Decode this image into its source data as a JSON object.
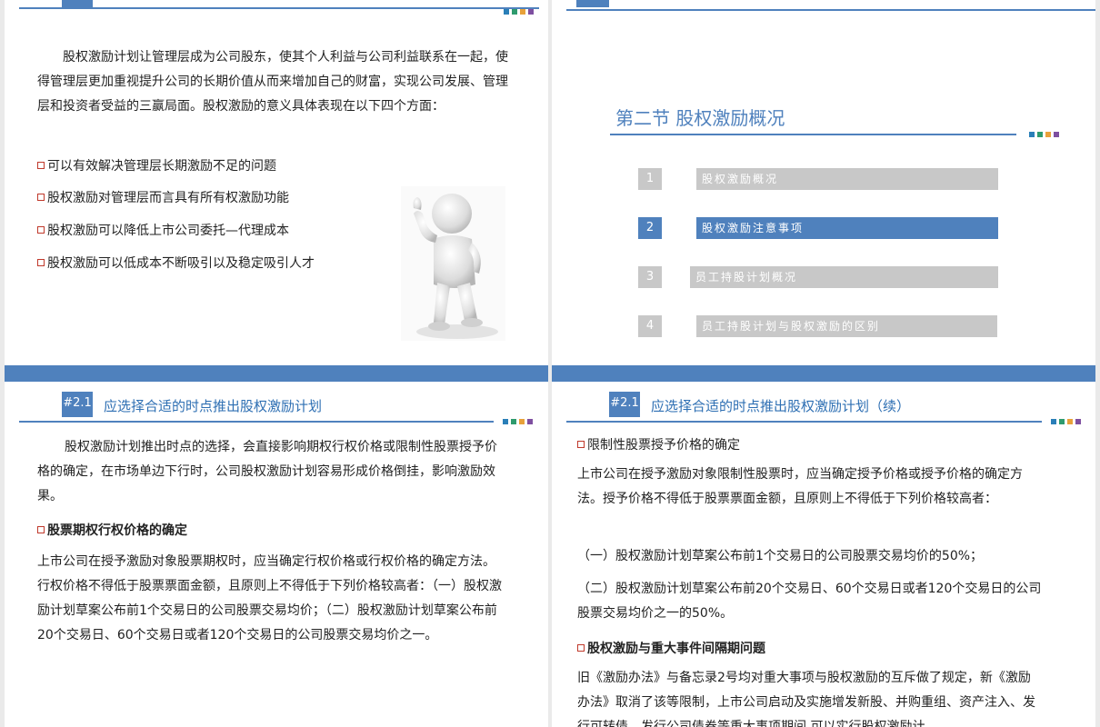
{
  "slide1": {
    "intro": "股权激励计划让管理层成为公司股东，使其个人利益与公司利益联系在一起，使得管理层更加重视提升公司的长期价值从而来增加自己的财富，实现公司发展、管理层和投资者受益的三赢局面。股权激励的意义具体表现在以下四个方面：",
    "bullets": [
      "可以有效解决管理层长期激励不足的问题",
      "股权激励对管理层而言具有所有权激励功能",
      "股权激励可以降低上市公司委托—代理成本",
      "股权激励可以低成本不断吸引以及稳定吸引人才"
    ]
  },
  "slide2": {
    "section_title": "第二节  股权激励概况",
    "toc": [
      {
        "num": "1",
        "label": "股权激励概况",
        "active": false
      },
      {
        "num": "2",
        "label": "股权激励注意事项",
        "active": true
      },
      {
        "num": "3",
        "label": "员工持股计划概况",
        "active": false
      },
      {
        "num": "4",
        "label": "员工持股计划与股权激励的区别",
        "active": false
      }
    ]
  },
  "slide3": {
    "tag": "#2.1",
    "title": "应选择合适的时点推出股权激励计划",
    "intro": "股权激励计划推出时点的选择，会直接影响期权行权价格或限制性股票授予价格的确定，在市场单边下行时，公司股权激励计划容易形成价格倒挂，影响激励效果。",
    "heading": "股票期权行权价格的确定",
    "body": "上市公司在授予激励对象股票期权时，应当确定行权价格或行权价格的确定方法。行权价格不得低于股票票面金额，且原则上不得低于下列价格较高者：（一）股权激励计划草案公布前1个交易日的公司股票交易均价；（二）股权激励计划草案公布前20个交易日、60个交易日或者120个交易日的公司股票交易均价之一。"
  },
  "slide4": {
    "tag": "#2.1",
    "title": "应选择合适的时点推出股权激励计划（续）",
    "heading1": "限制性股票授予价格的确定",
    "body1": "上市公司在授予激励对象限制性股票时，应当确定授予价格或授予价格的确定方法。授予价格不得低于股票票面金额，且原则上不得低于下列价格较高者：",
    "item1": "（一）股权激励计划草案公布前1个交易日的公司股票交易均价的50%；",
    "item2": "（二）股权激励计划草案公布前20个交易日、60个交易日或者120个交易日的公司股票交易均价之一的50%。",
    "heading2": "股权激励与重大事件间隔期问题",
    "body2": "旧《激励办法》与备忘录2号均对重大事项与股权激励的互斥做了规定，新《激励办法》取消了该等限制，上市公司启动及实施增发新股、并购重组、资产注入、发行可转债、发行公司债券等重大事项期间,可以实行股权激励计"
  },
  "colors": {
    "accent": "#4f81bd",
    "title_blue": "#2e6fb3",
    "toc_gray": "#c8c8c8",
    "bullet_red": "#c0392b",
    "squares": [
      "#2a7fb8",
      "#2e9b6e",
      "#e8a13a",
      "#7e4fa0"
    ]
  }
}
